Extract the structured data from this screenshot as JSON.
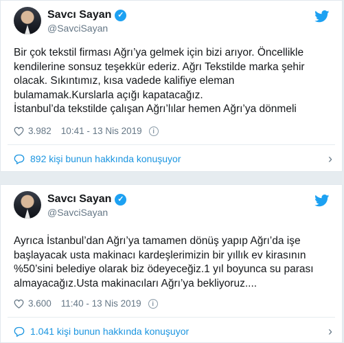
{
  "tweets": [
    {
      "author": {
        "name": "Savcı Sayan",
        "handle": "@SavciSayan"
      },
      "lines": [
        "Bir çok tekstil firması Ağrı’ya gelmek için bizi arıyor. Öncellikle",
        "kendilerine sonsuz teşekkür ederiz. Ağrı Tekstilde marka şehir",
        "olacak. Sıkıntımız, kısa vadede kalifiye eleman",
        "bulamamak.Kurslarla açığı kapatacağız.",
        "İstanbul’da tekstilde çalışan Ağrı’lılar hemen Ağrı’ya dönmeli"
      ],
      "likes": "3.982",
      "timestamp": "10:41 - 13 Nis 2019",
      "conversation": "892 kişi bunun hakkında konuşuyor"
    },
    {
      "author": {
        "name": "Savcı Sayan",
        "handle": "@SavciSayan"
      },
      "lines": [
        "Ayrıca İstanbul’dan Ağrı’ya tamamen dönüş yapıp Ağrı’da işe",
        "başlayacak usta makinacı kardeşlerimizin bir yıllık ev kirasının",
        "%50’sini belediye olarak biz ödeyeceğiz.1 yıl boyunca su parası",
        "almayacağız.Usta makinacıları Ağrı’ya  bekliyoruz...."
      ],
      "likes": "3.600",
      "timestamp": "11:40 - 13 Nis 2019",
      "conversation": "1.041 kişi bunun hakkında konuşuyor"
    }
  ],
  "icons": {
    "verified": "verified-check-icon",
    "brand": "twitter-bird-icon",
    "like": "heart-icon",
    "info": "info-icon",
    "reply": "speech-bubble-icon",
    "more": "chevron-right-icon"
  },
  "colors": {
    "brand": "#1da1f2",
    "link": "#1b95e0",
    "muted": "#657786",
    "background": "#e6ecf0"
  }
}
